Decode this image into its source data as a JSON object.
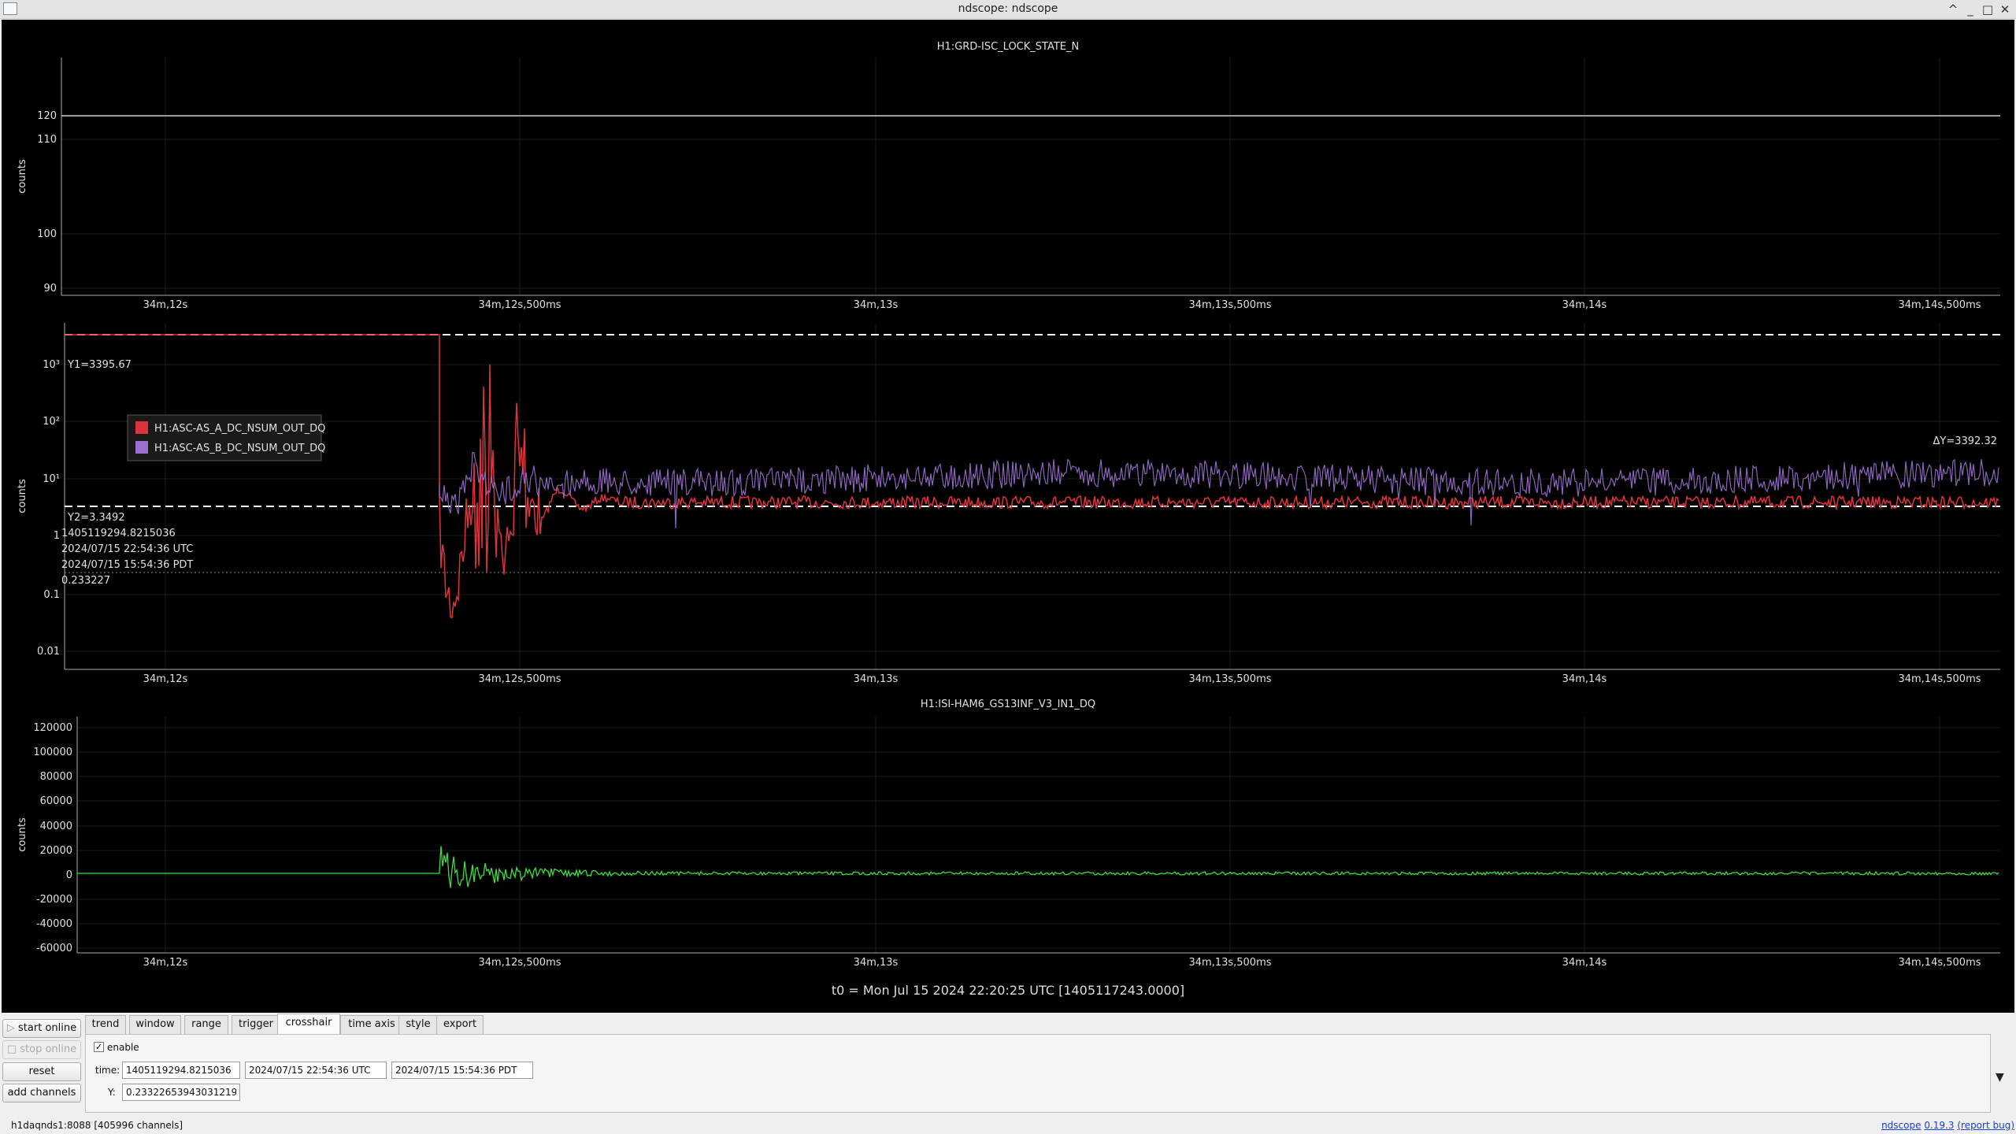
{
  "window": {
    "title": "ndscope: ndscope",
    "buttons": [
      "^",
      "_",
      "□",
      "✕"
    ]
  },
  "plots": [
    {
      "title": "H1:GRD-ISC_LOCK_STATE_N",
      "ylabel": "counts",
      "yticks": [
        "120",
        "110",
        "100",
        "90"
      ],
      "xticks": [
        "34m,12s",
        "34m,12s,500ms",
        "34m,13s",
        "34m,13s,500ms",
        "34m,14s",
        "34m,14s,500ms"
      ]
    },
    {
      "title": "",
      "ylabel": "counts",
      "yticks": [
        "10³",
        "10²",
        "10¹",
        "1",
        "0.1",
        "0.01"
      ],
      "xticks": [
        "34m,12s",
        "34m,12s,500ms",
        "34m,13s",
        "34m,13s,500ms",
        "34m,14s",
        "34m,14s,500ms"
      ],
      "legend": [
        {
          "name": "H1:ASC-AS_A_DC_NSUM_OUT_DQ",
          "color": "#e0323c"
        },
        {
          "name": "H1:ASC-AS_B_DC_NSUM_OUT_DQ",
          "color": "#9a6fcf"
        }
      ],
      "y1_label": "Y1=3395.67",
      "y2_label": "Y2=3.3492",
      "dy_label": "ΔY=3392.32",
      "cursor_lines": [
        "1405119294.8215036",
        "2024/07/15 22:54:36 UTC",
        "2024/07/15 15:54:36 PDT",
        "0.233227"
      ]
    },
    {
      "title": "H1:ISI-HAM6_GS13INF_V3_IN1_DQ",
      "ylabel": "counts",
      "yticks": [
        "120000",
        "100000",
        "80000",
        "60000",
        "40000",
        "20000",
        "0",
        "-20000",
        "-40000",
        "-60000"
      ],
      "xticks": [
        "34m,12s",
        "34m,12s,500ms",
        "34m,13s",
        "34m,13s,500ms",
        "34m,14s",
        "34m,14s,500ms"
      ],
      "trace_color": "#3ddc3d"
    }
  ],
  "t0_text": "t0 = Mon Jul 15 2024 22:20:25 UTC [1405117243.0000]",
  "side_buttons": {
    "start_online": "start online",
    "stop_online": "stop online",
    "reset": "reset",
    "add_channels": "add channels"
  },
  "tabs": [
    "trend",
    "window",
    "range",
    "trigger",
    "crosshair",
    "time axis",
    "style",
    "export"
  ],
  "active_tab": "crosshair",
  "crosshair": {
    "enable_label": "enable",
    "time_label": "time:",
    "time_gps": "1405119294.8215036",
    "time_utc": "2024/07/15 22:54:36 UTC",
    "time_pdt": "2024/07/15 15:54:36 PDT",
    "y_label": "Y:",
    "y_value": "0.23322653943031219"
  },
  "status": {
    "server": "h1daqnds1:8088  [405996 channels]",
    "app_link": "ndscope",
    "version": "0.19.3",
    "report": "(report bug)"
  }
}
